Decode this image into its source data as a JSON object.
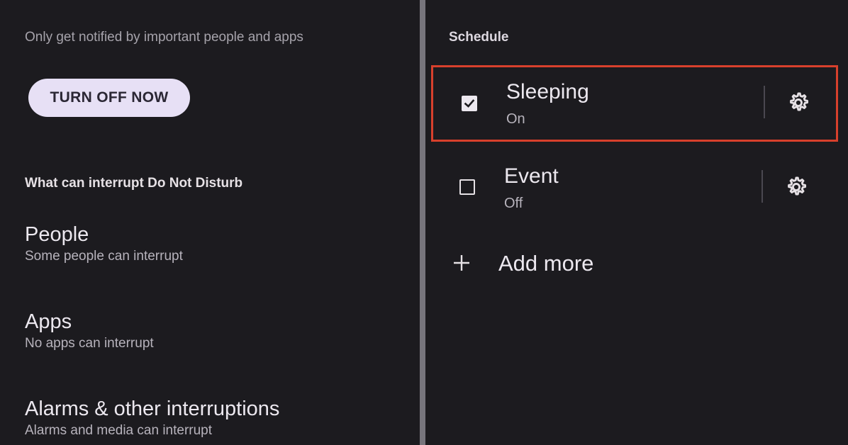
{
  "left": {
    "subtitle": "Only get notified by important people and apps",
    "turn_off_button": "TURN OFF NOW",
    "section_heading": "What can interrupt Do Not Disturb",
    "items": [
      {
        "title": "People",
        "subtitle": "Some people can interrupt"
      },
      {
        "title": "Apps",
        "subtitle": "No apps can interrupt"
      },
      {
        "title": "Alarms & other interruptions",
        "subtitle": "Alarms and media can interrupt"
      }
    ]
  },
  "right": {
    "section_label": "Schedule",
    "schedules": [
      {
        "title": "Sleeping",
        "status": "On",
        "checked": true,
        "icon": "gear-icon"
      },
      {
        "title": "Event",
        "status": "Off",
        "checked": false,
        "icon": "gear-icon"
      }
    ],
    "add_more": "Add more"
  },
  "colors": {
    "background": "#1c1b1f",
    "button_fill": "#e7e0f5",
    "highlight_border": "#d8402c"
  }
}
